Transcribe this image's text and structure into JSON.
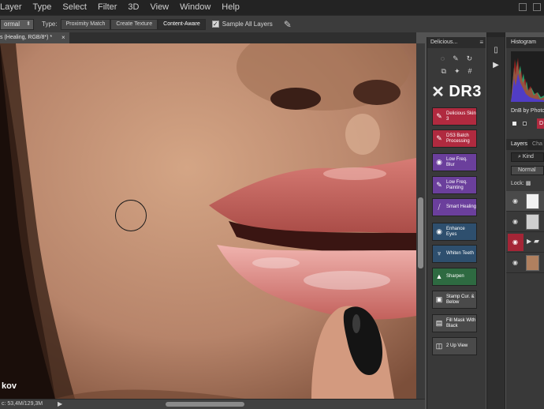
{
  "menubar": {
    "items": [
      "Layer",
      "Type",
      "Select",
      "Filter",
      "3D",
      "View",
      "Window",
      "Help"
    ]
  },
  "options_bar": {
    "mode": "ormal",
    "type_label": "Type:",
    "type_buttons": [
      "Proximity Match",
      "Create Texture",
      "Content-Aware"
    ],
    "active_type": "Content-Aware",
    "sample_all_layers_label": "Sample All Layers",
    "sample_all_layers_checked": true
  },
  "document_tab": {
    "title": "s (Healing, RGB/8*) *",
    "close": "×"
  },
  "canvas": {
    "watermark": "kov"
  },
  "status_bar": {
    "info": "c: 53,4M/129,3M",
    "play": "▶"
  },
  "delicious_panel": {
    "title": "Delicious...",
    "logo_text": "DR3",
    "tool_icons_row1": [
      "lasso-icon",
      "brush-icon",
      "rotate-icon"
    ],
    "tool_icons_row2": [
      "copy-icon",
      "sparkle-icon",
      "grid-icon"
    ],
    "buttons": [
      {
        "label": "Delicious Skin 3",
        "color": "#b02a3f",
        "icon": "brush-icon"
      },
      {
        "label": "DS3 Batch Processing",
        "color": "#b02a3f",
        "icon": "brush-icon"
      },
      {
        "label": "Low Freq. Blur",
        "color": "#6b3f9c",
        "icon": "droplet-icon"
      },
      {
        "label": "Low Freq. Painting",
        "color": "#6b3f9c",
        "icon": "brush-icon"
      },
      {
        "label": "Smart Healing",
        "color": "#6b3f9c",
        "icon": "bandage-icon"
      },
      {
        "label": "Enhance Eyes",
        "color": "#2e4f6e",
        "icon": "eye-icon"
      },
      {
        "label": "Whiten Teeth",
        "color": "#2e4f6e",
        "icon": "tooth-icon"
      },
      {
        "label": "Sharpen",
        "color": "#2e6a41",
        "icon": "triangle-icon"
      },
      {
        "label": "Stamp Cur. & Below",
        "color": "#4a4a4a",
        "icon": "stamp-icon"
      },
      {
        "label": "Fill Mask With Black",
        "color": "#4a4a4a",
        "icon": "mask-icon"
      },
      {
        "label": "2 Up View",
        "color": "#4a4a4a",
        "icon": "split-view-icon"
      }
    ]
  },
  "right_panel": {
    "histogram_title": "Histogram",
    "dnb_title": "DnB by Photo",
    "dnb_button": "D",
    "layers_tab": "Layers",
    "channels_tab": "Cha",
    "kind_label": "Kind",
    "blend_mode": "Normal",
    "lock_label": "Lock:",
    "layers": [
      {
        "type": "white-mask",
        "selected": true
      },
      {
        "type": "transparent",
        "selected": false
      },
      {
        "type": "group",
        "selected": false
      },
      {
        "type": "photo",
        "selected": false
      }
    ]
  }
}
